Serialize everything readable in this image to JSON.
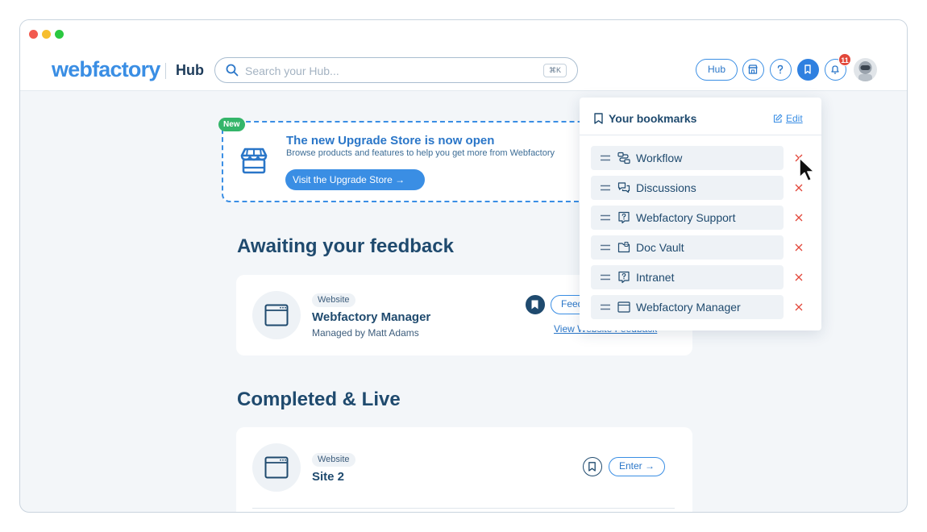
{
  "brand": {
    "logo": "webfactory",
    "section": "Hub"
  },
  "search": {
    "placeholder": "Search your Hub...",
    "shortcut": "⌘K"
  },
  "header_actions": {
    "hub_label": "Hub",
    "notification_count": "11"
  },
  "banner": {
    "badge": "New",
    "title": "The new Upgrade Store is now open",
    "description": "Browse products and features to help you get more from Webfactory",
    "cta": "Visit the Upgrade Store →"
  },
  "sections": {
    "awaiting": {
      "title": "Awaiting your feedback",
      "card": {
        "tag": "Website",
        "title": "Webfactory Manager",
        "subtitle": "Managed by Matt Adams",
        "action": "Feedback",
        "link": "View Website Feedback"
      }
    },
    "completed": {
      "title": "Completed & Live",
      "card": {
        "tag": "Website",
        "title": "Site 2",
        "action": "Enter →"
      }
    }
  },
  "bookmarks": {
    "title": "Your bookmarks",
    "edit": "Edit",
    "items": [
      {
        "label": "Workflow",
        "icon": "workflow-icon"
      },
      {
        "label": "Discussions",
        "icon": "discussions-icon"
      },
      {
        "label": "Webfactory Support",
        "icon": "support-icon"
      },
      {
        "label": "Doc Vault",
        "icon": "doc-vault-icon"
      },
      {
        "label": "Intranet",
        "icon": "intranet-icon"
      },
      {
        "label": "Webfactory Manager",
        "icon": "browser-window-icon"
      }
    ]
  },
  "colors": {
    "accent": "#3a8ee4",
    "text_dark": "#1f4a6e",
    "remove": "#e2473a",
    "new_badge": "#34b56a"
  }
}
